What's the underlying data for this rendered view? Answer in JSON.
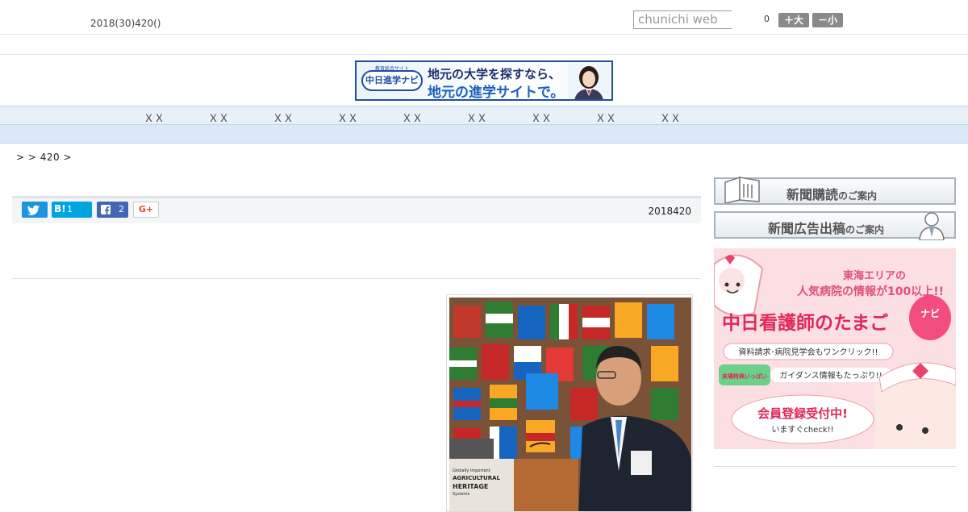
{
  "header": {
    "date": "2018(30)420()",
    "search_placeholder": "chunichi web",
    "font_count": "0",
    "font_bigger": "＋大",
    "font_smaller": "－小"
  },
  "banner": {
    "logo_sub": "教育総合サイト",
    "logo": "中日進学ナビ",
    "line1": "地元の大学を探すなら、",
    "line2": "地元の進学サイトで。"
  },
  "nav": {
    "items": [
      "ＸＸ",
      "ＸＸ",
      "ＸＸ",
      "ＸＸ",
      "ＸＸ",
      "ＸＸ",
      "ＸＸ",
      "ＸＸ",
      "ＸＸ"
    ]
  },
  "breadcrumb": ">  > 420 >",
  "article": {
    "share": {
      "hatena_label": "B!",
      "hatena_count": "1",
      "facebook_count": "2",
      "gplus_label": "G+"
    },
    "date": "2018420"
  },
  "photo": {
    "podium_line1": "Globally Important",
    "podium_line2": "AGRICULTURAL",
    "podium_line3": "HERITAGE",
    "podium_line4": "Systems"
  },
  "sidebar": {
    "subscribe_main": "新聞購読",
    "subscribe_sub": "のご案内",
    "advertise_main": "新聞広告出稿",
    "advertise_sub": "のご案内",
    "ad": {
      "line1": "東海エリアの",
      "line2": "人気病院の情報が100以上!!",
      "title": "中日看護師のたまご",
      "navi": "ナビ",
      "info1": "資料請求･病院見学会もワンクリック!!",
      "tag": "来場特典いっぱい",
      "info2": "ガイダンス情報もたっぷり!!",
      "cta": "会員登録受付中!",
      "cta_sub": "いますぐcheck!!"
    }
  },
  "colors": {
    "twitter": "#1b95e0",
    "hatena": "#00a4de",
    "facebook": "#4267b2",
    "nav_bg": "#e8f1fa",
    "ad_bg": "#fbd6da"
  }
}
